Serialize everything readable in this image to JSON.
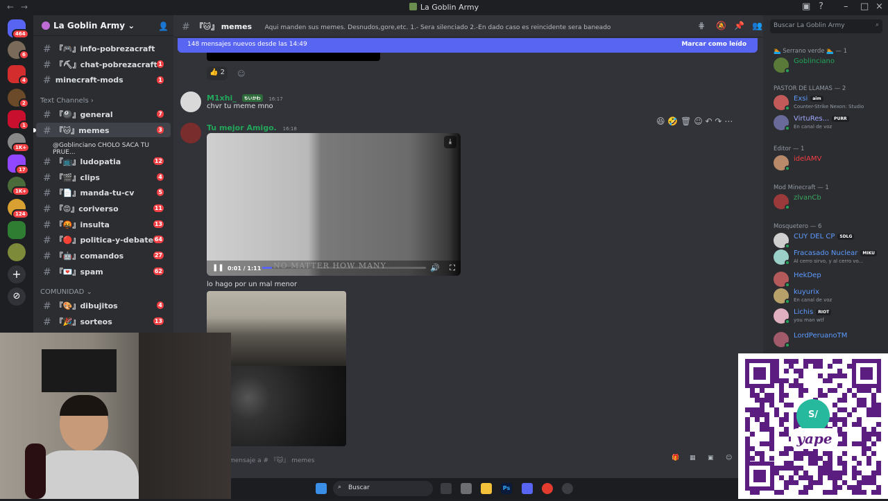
{
  "window": {
    "title": "La Goblin Army"
  },
  "servers": {
    "badges": [
      "464",
      "6",
      "4",
      "2",
      "1",
      "1K+",
      "17",
      "1K+",
      "124"
    ]
  },
  "guild": {
    "name": "La Goblin Army"
  },
  "channels": [
    {
      "emoji": "『🎮』",
      "name": "info-pobrezacraft",
      "count": ""
    },
    {
      "emoji": "『⛏』",
      "name": "chat-pobrezacraft",
      "count": "1"
    },
    {
      "emoji": "",
      "name": "minecraft-mods",
      "count": "1"
    }
  ],
  "text_category": "Text Channels",
  "text_channels": [
    {
      "emoji": "『🎱』",
      "name": "general",
      "count": "7"
    },
    {
      "emoji": "『🐱』",
      "name": "memes",
      "count": "3"
    },
    {
      "emoji": "『📺』",
      "name": "ludopatia",
      "count": "12"
    },
    {
      "emoji": "『🎬』",
      "name": "clips",
      "count": "4"
    },
    {
      "emoji": "『📄』",
      "name": "manda-tu-cv",
      "count": "5"
    },
    {
      "emoji": "『😡』",
      "name": "coriverso",
      "count": "11"
    },
    {
      "emoji": "『🤬』",
      "name": "insulta",
      "count": "13"
    },
    {
      "emoji": "『🔴』",
      "name": "politica-y-debate",
      "count": "64"
    },
    {
      "emoji": "『🤖』",
      "name": "comandos",
      "count": "27"
    },
    {
      "emoji": "『💌』",
      "name": "spam",
      "count": "62"
    }
  ],
  "thread_preview": "@Goblinciano CHOLO SACA TU PRUE...",
  "community_category": "COMUNIDAD",
  "community_channels": [
    {
      "emoji": "『🎨』",
      "name": "dibujitos",
      "count": "4"
    },
    {
      "emoji": "『🎉』",
      "name": "sorteos",
      "count": "13"
    }
  ],
  "header": {
    "channel": "memes",
    "channel_emoji": "『🐱』",
    "topic": "Aqui manden sus memes. Desnudos,gore,etc. 1.- Sera silenciado 2.-En dado caso es reincidente sera baneado"
  },
  "newbar": {
    "text": "148 mensajes nuevos desde las 14:49",
    "mark": "Marcar como leído"
  },
  "reaction": {
    "emoji": "👍",
    "count": "2"
  },
  "messages": [
    {
      "author": "M1xhi_",
      "tag": "ちいかわ",
      "time": "16:17",
      "text": "chvr tu meme mno",
      "color": "#23a55a"
    },
    {
      "author": "Tu mejor Amigo.",
      "time": "16:18",
      "color": "#23a55a"
    }
  ],
  "video": {
    "time": "0:01 / 1:11",
    "overlay_text": "NO MATTER HOW MANY",
    "progress": 0.06
  },
  "caption": "lo hago por un mal menor",
  "composer": {
    "placeholder": "mensaje a # 『🐱』 memes"
  },
  "search": {
    "placeholder": "Buscar La Goblin Army"
  },
  "members": [
    {
      "role": "🏊 Serrano verde 🏊 — 1",
      "people": [
        {
          "name": "Goblinciano",
          "color": "#23a55a",
          "activity": "",
          "tag": ""
        }
      ]
    },
    {
      "role": "PASTOR DE LLAMAS — 2",
      "people": [
        {
          "name": "Exsi",
          "color": "#5d9bff",
          "activity": "Counter-Strike Nexon: Studio",
          "tag": "aim"
        },
        {
          "name": "VirtuRes...",
          "color": "#a0a8ff",
          "activity": "En canal de voz",
          "tag": "PURR"
        }
      ]
    },
    {
      "role": "Editor — 1",
      "people": [
        {
          "name": "idelAMV",
          "color": "#f23f43",
          "activity": "",
          "tag": ""
        }
      ]
    },
    {
      "role": "Mod Minecraft — 1",
      "people": [
        {
          "name": "zlvanCb",
          "color": "#3ba55d",
          "activity": "",
          "tag": ""
        }
      ]
    },
    {
      "role": "Mosquetero — 6",
      "people": [
        {
          "name": "CUY DEL CP",
          "color": "#5d9bff",
          "activity": "",
          "tag": "SDLG"
        },
        {
          "name": "Fracasado Nuclear",
          "color": "#5d9bff",
          "activity": "Al cerro sirvo, y al cerro vo...",
          "tag": "MIKU"
        },
        {
          "name": "HekDep",
          "color": "#5d9bff",
          "activity": "",
          "tag": ""
        },
        {
          "name": "kuyurix",
          "color": "#5d9bff",
          "activity": "En canal de voz",
          "tag": ""
        },
        {
          "name": "Lichis",
          "color": "#5d9bff",
          "activity": "you man wtf",
          "tag": "RIOT"
        },
        {
          "name": "LordPeruanoTM",
          "color": "#5d9bff",
          "activity": "",
          "tag": ""
        }
      ]
    }
  ],
  "taskbar": {
    "search": "Buscar"
  },
  "qr": {
    "brand": "yape",
    "badge": "S/"
  }
}
